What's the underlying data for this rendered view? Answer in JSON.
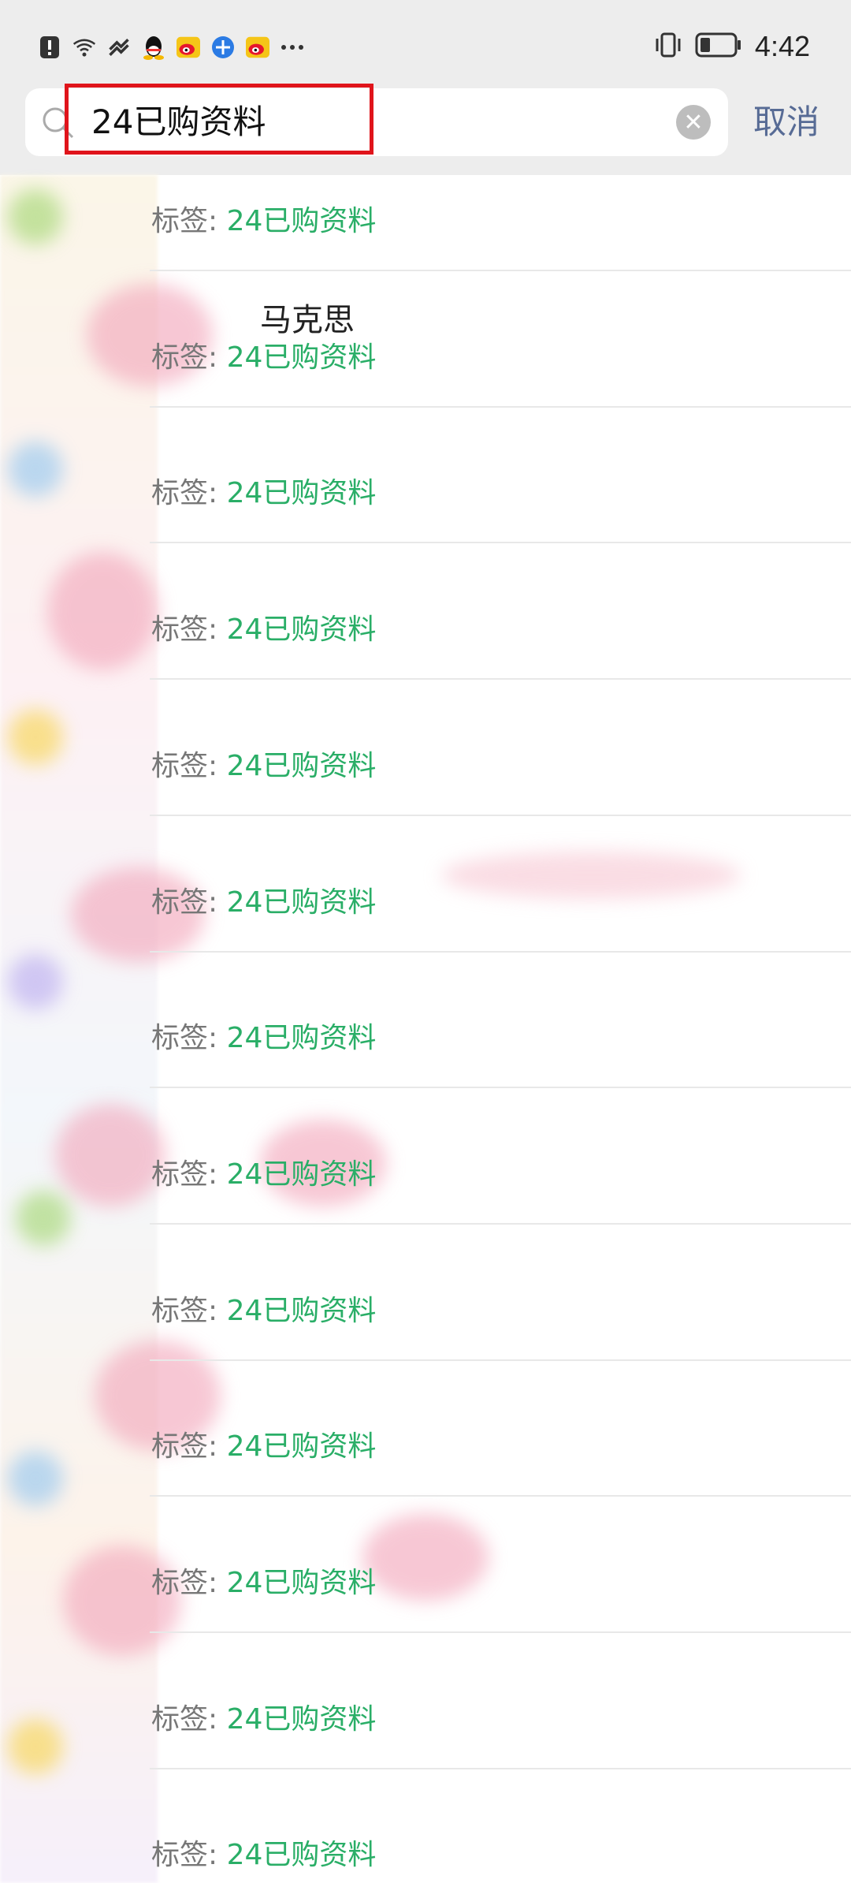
{
  "status_bar": {
    "time": "4:42",
    "left_icons": [
      "alert-icon",
      "wifi-icon",
      "link-icon",
      "qq-icon",
      "weibo-icon",
      "browser-icon",
      "weibo-icon",
      "more-dots-icon"
    ],
    "right_icons": [
      "vibrate-icon",
      "battery-icon"
    ]
  },
  "search": {
    "query": "24已购资料",
    "cancel_label": "取消"
  },
  "results": {
    "tag_prefix": "标签:",
    "items": [
      {
        "title": "",
        "tag": "24已购资料"
      },
      {
        "title": "马克思",
        "tag": "24已购资料"
      },
      {
        "title": "",
        "tag": "24已购资料"
      },
      {
        "title": "",
        "tag": "24已购资料"
      },
      {
        "title": "",
        "tag": "24已购资料"
      },
      {
        "title": "",
        "tag": "24已购资料"
      },
      {
        "title": "",
        "tag": "24已购资料"
      },
      {
        "title": "",
        "tag": "24已购资料"
      },
      {
        "title": "",
        "tag": "24已购资料"
      },
      {
        "title": "",
        "tag": "24已购资料"
      },
      {
        "title": "",
        "tag": "24已购资料"
      },
      {
        "title": "",
        "tag": "24已购资料"
      },
      {
        "title": "",
        "tag": "24已购资料"
      }
    ]
  },
  "colors": {
    "tag_green": "#2aae67",
    "cancel_blue": "#576b95",
    "highlight_red": "#e0141b"
  }
}
